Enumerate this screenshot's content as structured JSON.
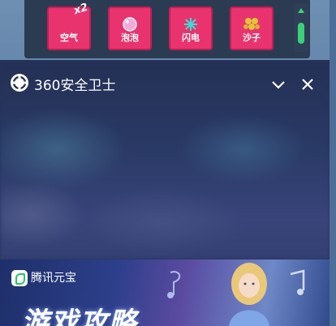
{
  "toolbar": {
    "items": [
      {
        "label": "空气",
        "icon": "wind-icon",
        "badge": "x2"
      },
      {
        "label": "泡泡",
        "icon": "bubble-icon"
      },
      {
        "label": "闪电",
        "icon": "spark-icon"
      },
      {
        "label": "沙子",
        "icon": "sand-icon"
      }
    ]
  },
  "panel": {
    "title": "360安全卫士",
    "icons": [
      "360-logo-icon",
      "chevron-down-icon",
      "close-icon"
    ]
  },
  "ad": {
    "sponsor": "腾讯元宝",
    "headline": "游戏攻略"
  },
  "colors": {
    "tool_bg": "#e8336f",
    "toolbar_bg": "#2b3c52",
    "scroll_accent": "#3ad17b",
    "panel_bg": "#25335a"
  }
}
